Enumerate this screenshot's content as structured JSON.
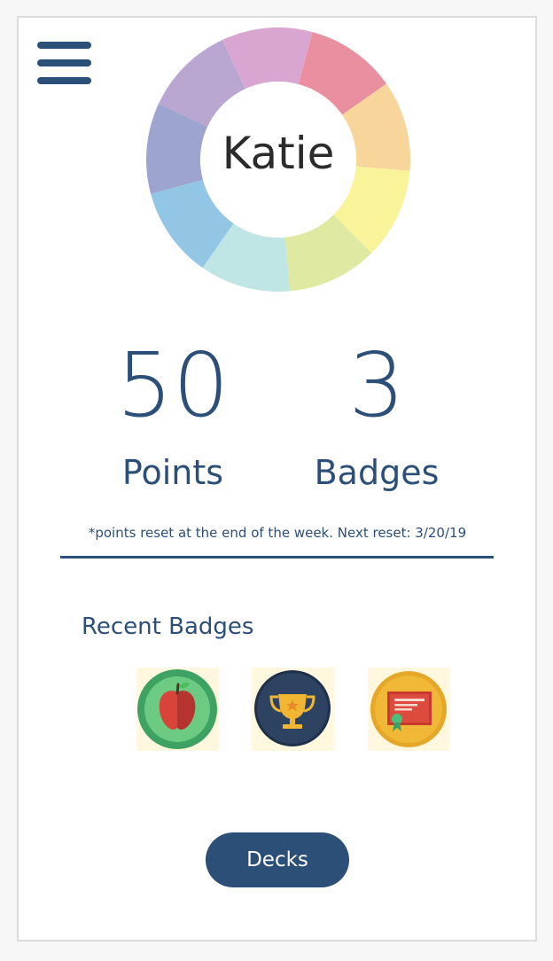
{
  "profile": {
    "name": "Katie",
    "wheel_colors": [
      "#ea8fa0",
      "#f7d59b",
      "#f9f49a",
      "#dfe9a1",
      "#bfe5e4",
      "#93c6e4",
      "#9da4cf",
      "#b9a7d2",
      "#d9a6d2"
    ]
  },
  "stats": {
    "points_value": "50",
    "points_label": "Points",
    "badges_value": "3",
    "badges_label": "Badges",
    "reset_note": "*points reset at the end of the week. Next reset: 3/20/19"
  },
  "recent_badges": {
    "title": "Recent Badges",
    "items": [
      {
        "icon": "apple-icon"
      },
      {
        "icon": "trophy-icon"
      },
      {
        "icon": "certificate-icon"
      }
    ]
  },
  "actions": {
    "decks_label": "Decks"
  },
  "colors": {
    "accent": "#2c4f78"
  }
}
